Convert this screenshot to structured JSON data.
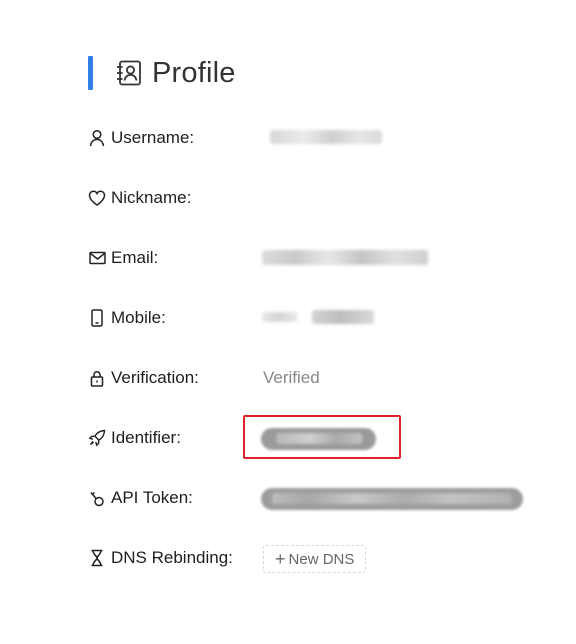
{
  "header": {
    "title": "Profile",
    "icon": "contact-card-icon",
    "accent_color": "#2f7fe6"
  },
  "fields": {
    "username": {
      "label": "Username:",
      "icon": "user-icon"
    },
    "nickname": {
      "label": "Nickname:",
      "icon": "heart-icon"
    },
    "email": {
      "label": "Email:",
      "icon": "mail-icon"
    },
    "mobile": {
      "label": "Mobile:",
      "icon": "mobile-phone-icon"
    },
    "verification": {
      "label": "Verification:",
      "icon": "lock-icon",
      "value": "Verified"
    },
    "identifier": {
      "label": "Identifier:",
      "icon": "rocket-icon"
    },
    "api_token": {
      "label": "API Token:",
      "icon": "key-icon"
    },
    "dns_rebinding": {
      "label": "DNS Rebinding:",
      "icon": "hourglass-icon",
      "button_label": "New DNS"
    }
  },
  "highlight_color": "#e0222c"
}
